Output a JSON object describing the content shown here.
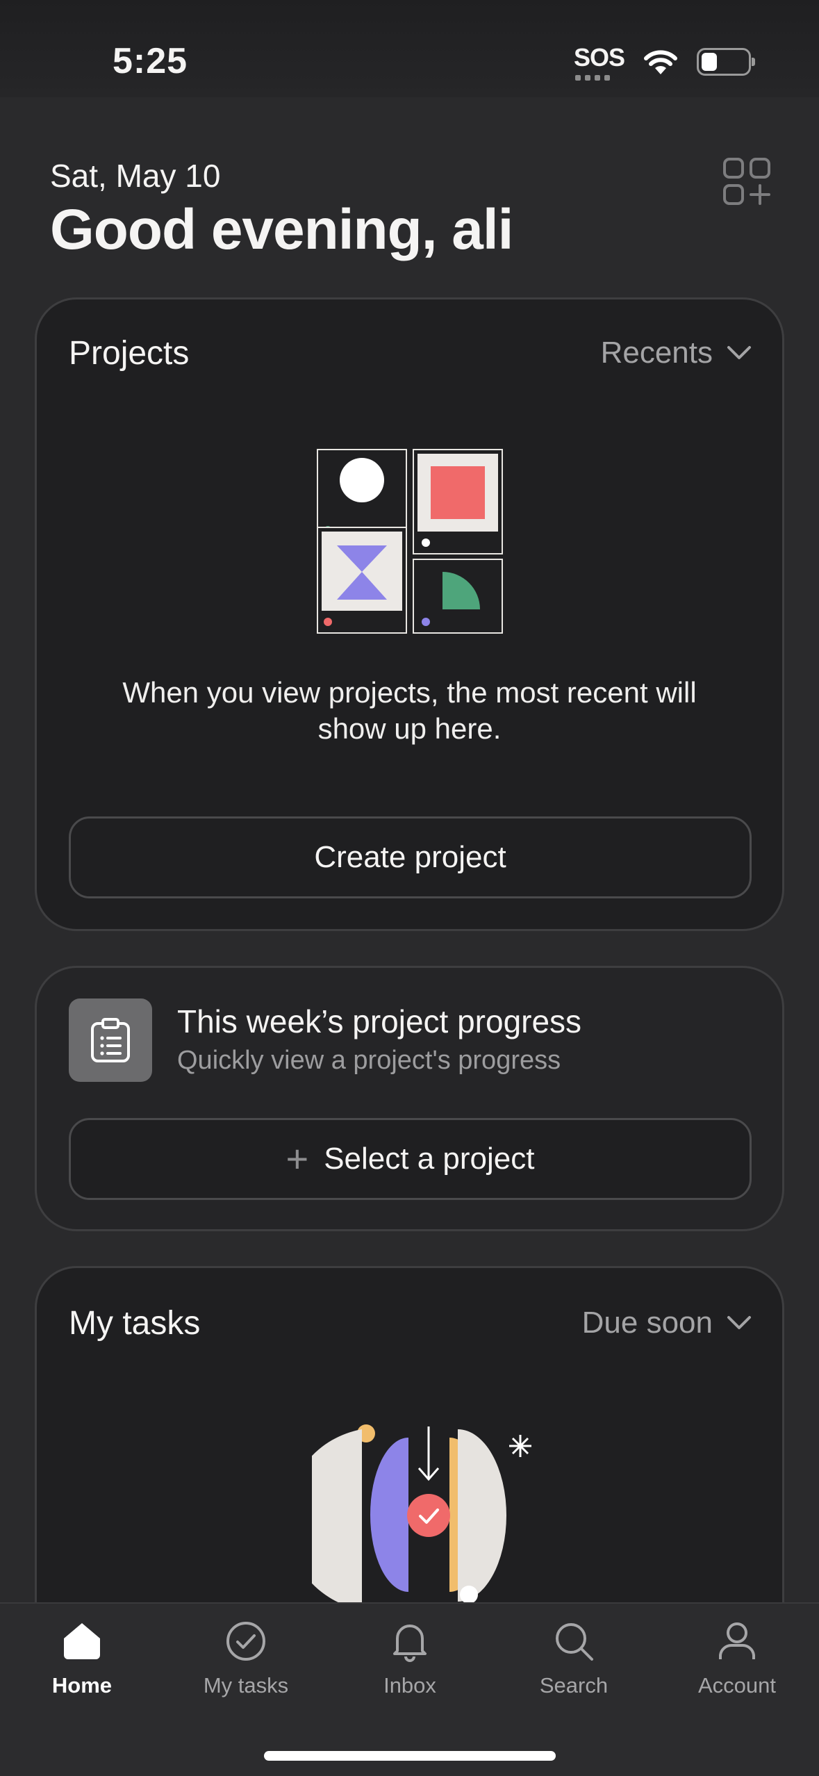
{
  "status_bar": {
    "time": "5:25",
    "sos": "SOS"
  },
  "header": {
    "date": "Sat, May 10",
    "greeting": "Good evening, ali"
  },
  "projects_card": {
    "title": "Projects",
    "filter": "Recents",
    "empty_text_line1": "When you view projects, the most recent will",
    "empty_text_line2": "show up here.",
    "create_button": "Create project"
  },
  "progress_card": {
    "title": "This week’s project progress",
    "subtitle": "Quickly view a project's progress",
    "select_button": "Select a project"
  },
  "tasks_card": {
    "title": "My tasks",
    "filter": "Due soon"
  },
  "bottom_nav": {
    "items": [
      {
        "label": "Home",
        "icon": "home-icon",
        "active": true
      },
      {
        "label": "My tasks",
        "icon": "check-circle-icon",
        "active": false
      },
      {
        "label": "Inbox",
        "icon": "bell-icon",
        "active": false
      },
      {
        "label": "Search",
        "icon": "search-icon",
        "active": false
      },
      {
        "label": "Account",
        "icon": "user-icon",
        "active": false
      }
    ]
  },
  "colors": {
    "background": "#2a2a2c",
    "card": "#1f1f21",
    "coral": "#f06a6a",
    "purple": "#8d84e8",
    "green": "#4ea57b",
    "yellow": "#f1bd6c"
  }
}
